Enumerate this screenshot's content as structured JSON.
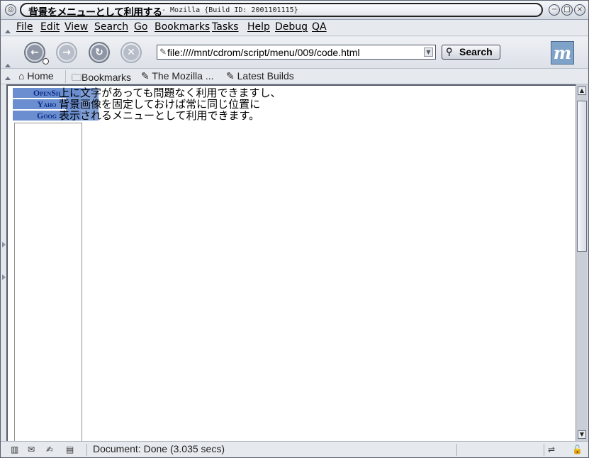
{
  "window": {
    "title_main": "背景をメニューとして利用する",
    "title_sub": "- Mozilla {Build ID: 2001101115}"
  },
  "menubar": {
    "items": [
      "File",
      "Edit",
      "View",
      "Search",
      "Go",
      "Bookmarks",
      "Tasks",
      "Help",
      "Debug",
      "QA"
    ]
  },
  "navbar": {
    "url": "file:////mnt/cdrom/script/menu/009/code.html",
    "search_label": "Search",
    "logo": "m"
  },
  "personal_toolbar": {
    "home": "Home",
    "bookmarks": "Bookmarks",
    "mozilla": "The Mozilla ...",
    "latest": "Latest Builds"
  },
  "page": {
    "menu_links": [
      "OpenSh",
      "Yaho",
      "Goog"
    ],
    "body_lines": [
      "上に文字があっても問題なく利用できますし、",
      "背景画像を固定しておけば常に同じ位置に",
      "表示されるメニューとして利用できます。"
    ]
  },
  "statusbar": {
    "text": "Document: Done (3.035 secs)"
  },
  "icons": {
    "back": "back-arrow-icon",
    "forward": "forward-arrow-icon",
    "reload": "reload-icon",
    "stop": "stop-icon"
  }
}
